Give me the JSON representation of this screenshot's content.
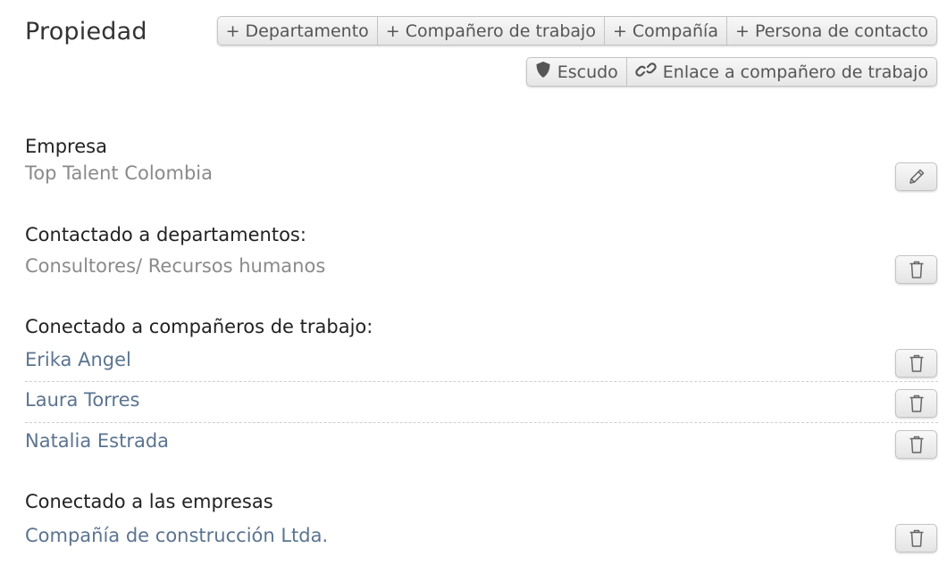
{
  "page": {
    "title": "Propiedad"
  },
  "toolbar": {
    "add_buttons": [
      {
        "label": "+ Departamento"
      },
      {
        "label": "+ Compañero de trabajo"
      },
      {
        "label": "+ Compañía"
      },
      {
        "label": "+ Persona de contacto"
      }
    ],
    "shield_label": "Escudo",
    "link_label": "Enlace a compañero de trabajo"
  },
  "sections": {
    "empresa": {
      "label": "Empresa",
      "value": "Top Talent Colombia"
    },
    "departamentos": {
      "label": "Contactado a departamentos:",
      "items": [
        {
          "name": "Consultores/ Recursos humanos"
        }
      ]
    },
    "companeros": {
      "label": "Conectado a compañeros de trabajo:",
      "items": [
        {
          "name": "Erika Angel"
        },
        {
          "name": "Laura Torres"
        },
        {
          "name": "Natalia Estrada"
        }
      ]
    },
    "empresas": {
      "label": "Conectado a las empresas",
      "items": [
        {
          "name": "Compañía de construcción Ltda."
        }
      ]
    }
  },
  "icons": {
    "shield": "shield-icon",
    "link": "link-icon",
    "edit": "pencil-icon",
    "delete": "trash-icon"
  },
  "colors": {
    "link_text": "#5b7490",
    "muted_text": "#8a8a8a"
  }
}
